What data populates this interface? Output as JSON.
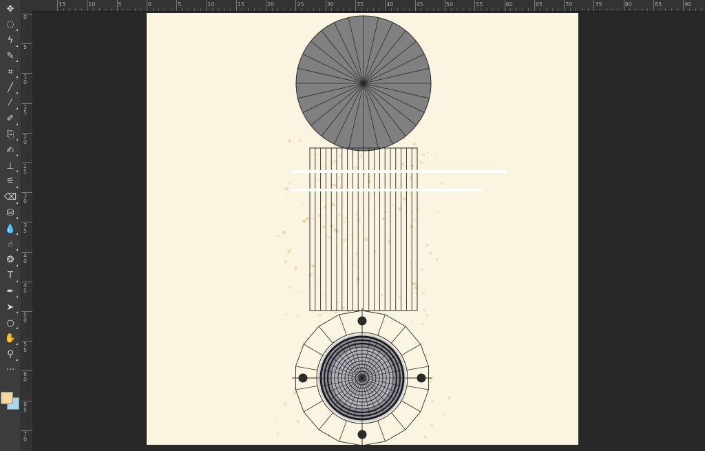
{
  "ruler_top": [
    "15",
    "10",
    "5",
    "0",
    "5",
    "10",
    "15",
    "20",
    "25",
    "30",
    "35",
    "40",
    "45",
    "50",
    "55",
    "60",
    "65",
    "70",
    "75",
    "80",
    "85",
    "90"
  ],
  "ruler_left": [
    "0",
    "5",
    "10",
    "15",
    "20",
    "25",
    "30",
    "35",
    "40",
    "45",
    "50",
    "55",
    "60",
    "65",
    "70"
  ],
  "tools": [
    {
      "name": "move-tool-icon",
      "glyph": "✥"
    },
    {
      "name": "elliptical-marquee-tool-icon",
      "glyph": "◌"
    },
    {
      "name": "lasso-tool-icon",
      "glyph": "ϟ"
    },
    {
      "name": "quick-selection-tool-icon",
      "glyph": "✎"
    },
    {
      "name": "crop-tool-icon",
      "glyph": "⌗"
    },
    {
      "name": "eyedropper-tool-icon",
      "glyph": "╱"
    },
    {
      "name": "healing-brush-tool-icon",
      "glyph": "⁄"
    },
    {
      "name": "brush-tool-icon",
      "glyph": "✐"
    },
    {
      "name": "clone-stamp-tool-icon",
      "glyph": "⎘"
    },
    {
      "name": "history-brush-tool-icon",
      "glyph": "✍"
    },
    {
      "name": "stamp-tool-icon",
      "glyph": "⊥"
    },
    {
      "name": "mixer-brush-tool-icon",
      "glyph": "⚟"
    },
    {
      "name": "eraser-tool-icon",
      "glyph": "⌫"
    },
    {
      "name": "paint-bucket-tool-icon",
      "glyph": "⛁"
    },
    {
      "name": "blur-tool-icon",
      "glyph": "💧"
    },
    {
      "name": "smudge-tool-icon",
      "glyph": "☝"
    },
    {
      "name": "sponge-tool-icon",
      "glyph": "❂"
    },
    {
      "name": "type-tool-icon",
      "glyph": "T"
    },
    {
      "name": "pen-tool-icon",
      "glyph": "✒"
    },
    {
      "name": "path-selection-tool-icon",
      "glyph": "➤"
    },
    {
      "name": "ellipse-tool-icon",
      "glyph": "○"
    },
    {
      "name": "hand-tool-icon",
      "glyph": "✋"
    },
    {
      "name": "zoom-tool-icon",
      "glyph": "⚲"
    },
    {
      "name": "more-tools-icon",
      "glyph": "···"
    }
  ],
  "colors": {
    "foreground": "#f2d9a0",
    "background": "#a8d8ee",
    "document": "#faf4e0",
    "circle_fill": "#808080"
  }
}
